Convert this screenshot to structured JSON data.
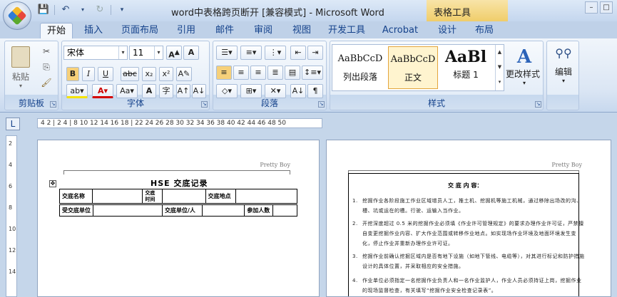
{
  "window": {
    "title": "word中表格跨页断开 [兼容模式] - Microsoft Word",
    "context_tab_title": "表格工具"
  },
  "tabs": [
    "开始",
    "插入",
    "页面布局",
    "引用",
    "邮件",
    "审阅",
    "视图",
    "开发工具",
    "Acrobat",
    "设计",
    "布局"
  ],
  "clipboard": {
    "paste_label": "粘贴",
    "group_label": "剪贴板"
  },
  "font": {
    "family": "宋体",
    "size": "11",
    "group_label": "字体"
  },
  "paragraph": {
    "group_label": "段落"
  },
  "styles": {
    "group_label": "样式",
    "items": [
      {
        "preview": "AaBbCcD",
        "name": "列出段落"
      },
      {
        "preview": "AaBbCcD",
        "name": "正文"
      },
      {
        "preview": "AaBl",
        "name": "标题 1"
      }
    ],
    "change_styles": "更改样式"
  },
  "editing": {
    "label": "编辑"
  },
  "ruler": {
    "ticks": "4  2  |  2  4  |  8  10  12  14  16  18  |  22  24  26  28  30  32  34  36  38  40  42  44  46  48  50",
    "vticks": [
      "2",
      "4",
      "6",
      "8",
      "10",
      "12",
      "14"
    ]
  },
  "doc": {
    "header_text": "Pretty Boy",
    "title": "HSE 交底记录",
    "table": {
      "row1": [
        "交底名称",
        "",
        "交底\n时间",
        "",
        "交底地点",
        ""
      ],
      "row2": [
        "受交底单位",
        "",
        "交底单位/人",
        "",
        "参加人数",
        ""
      ]
    },
    "content_title": "交 底 内 容：",
    "items": [
      {
        "num": "1.",
        "text": "挖掘作业各阶段施工作业区域增员人工，推土机、挖掘机等施工机械，通过移除出场改的沟、槽、坑或运在的槽。行驶、运输入当作业。"
      },
      {
        "num": "2.",
        "text": "开挖深度超过 0.5 米的挖掘作业必须填《作业许可管理规定》的要求办理作业许可证，严禁擅自变更挖掘作业内容、扩大作业范围或转移作业地点。如实现场作业环境及地面环境发生变化，停止作业并重新办理作业许可证。"
      },
      {
        "num": "3.",
        "text": "挖掘作业前确认挖掘区域内是否有地下设施（如地下管线、电缆等），对其进行标记和防护措施设计的具体位置，并采取相应的安全措施。"
      },
      {
        "num": "4.",
        "text": "作业单位必须指定一名挖掘作业负责人和一名作业监护人，作业人员必须持证上岗，挖掘作业的现场监督检查，有关填写“挖掘作业安全检查记录表”。"
      }
    ]
  }
}
